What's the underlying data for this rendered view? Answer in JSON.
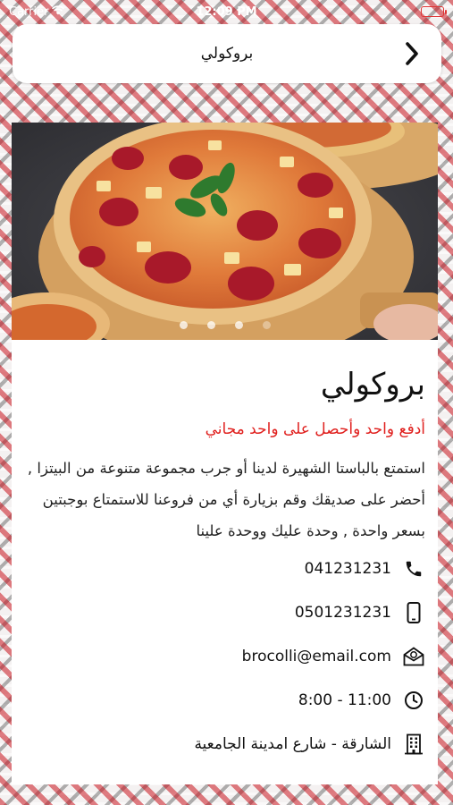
{
  "status_bar": {
    "carrier": "Carrier",
    "time": "12:09 PM"
  },
  "nav": {
    "title": "بروكولي",
    "back_icon": "chevron-right-icon"
  },
  "slider": {
    "image": "pepperoni pizza",
    "page_count": 4,
    "current_page": 4
  },
  "restaurant": {
    "name": "بروكولي",
    "offer": "أدفع واحد وأحصل على واحد مجاني",
    "description": "استمتع بالباستا الشهيرة لدينا أو جرب مجموعة متنوعة من البيتزا , أحضر على صديقك وقم بزيارة أي من فروعنا للاستمتاع بوجبتين بسعر واحدة , وحدة عليك ووحدة علينا"
  },
  "info": [
    {
      "icon": "phone-icon",
      "text": "041231231"
    },
    {
      "icon": "mobile-icon",
      "text": "0501231231"
    },
    {
      "icon": "email-icon",
      "text": "brocolli@email.com"
    },
    {
      "icon": "clock-icon",
      "text": "8:00 - 11:00"
    },
    {
      "icon": "building-icon",
      "text": "الشارقة - شارع امدينة الجامعية"
    }
  ],
  "colors": {
    "offer": "#e0201e",
    "background_pattern": "#c8141e"
  }
}
